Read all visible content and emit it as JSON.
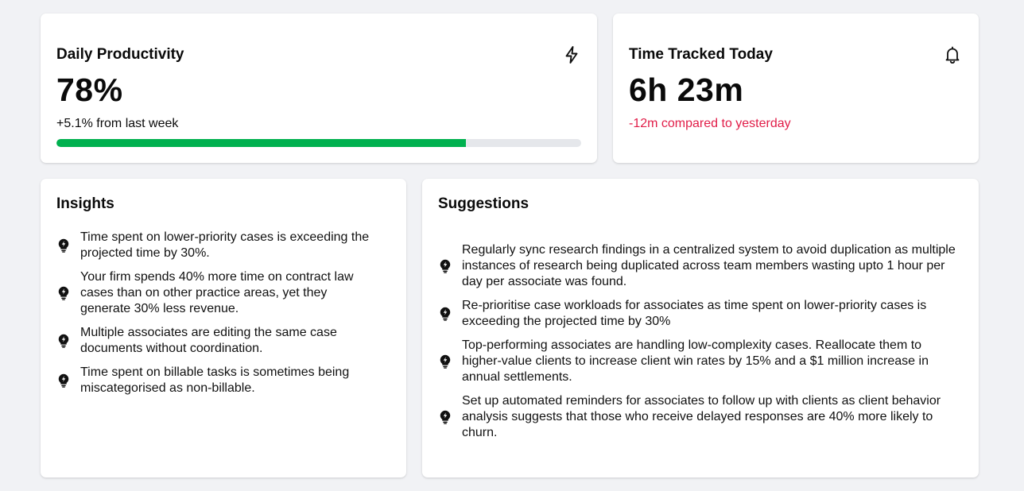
{
  "productivity": {
    "title": "Daily Productivity",
    "icon": "lightning-icon",
    "value": "78%",
    "change": "+5.1% from last week",
    "progress_percent": 78,
    "colors": {
      "progress": "#00b14f",
      "track": "#e5e7eb"
    }
  },
  "time_tracked": {
    "title": "Time Tracked Today",
    "icon": "bell-icon",
    "value": "6h 23m",
    "change": "-12m compared to yesterday",
    "colors": {
      "change": "#e11d48"
    }
  },
  "insights": {
    "title": "Insights",
    "icon": "lightbulb-icon",
    "items": [
      "Time spent on lower-priority cases is exceeding the projected time by 30%.",
      "Your firm spends 40% more time on contract law cases than on other practice areas, yet they generate 30% less revenue.",
      "Multiple associates are editing the same case documents without coordination.",
      "Time spent on billable tasks is sometimes being miscategorised as non-billable."
    ]
  },
  "suggestions": {
    "title": "Suggestions",
    "icon": "lightbulb-icon",
    "items": [
      "Regularly sync research findings in a centralized system to avoid duplication as multiple instances of research being duplicated across team members wasting upto 1 hour per day per associate was found.",
      "Re-prioritise case workloads for associates as time spent on lower-priority cases is exceeding the projected time by 30%",
      "Top-performing associates are handling low-complexity cases. Reallocate them to higher-value clients to increase client win rates by 15% and a $1 million increase in annual settlements.",
      "Set up automated reminders for associates to follow up with clients as client behavior analysis suggests that those who receive delayed responses are 40% more likely to churn."
    ]
  }
}
